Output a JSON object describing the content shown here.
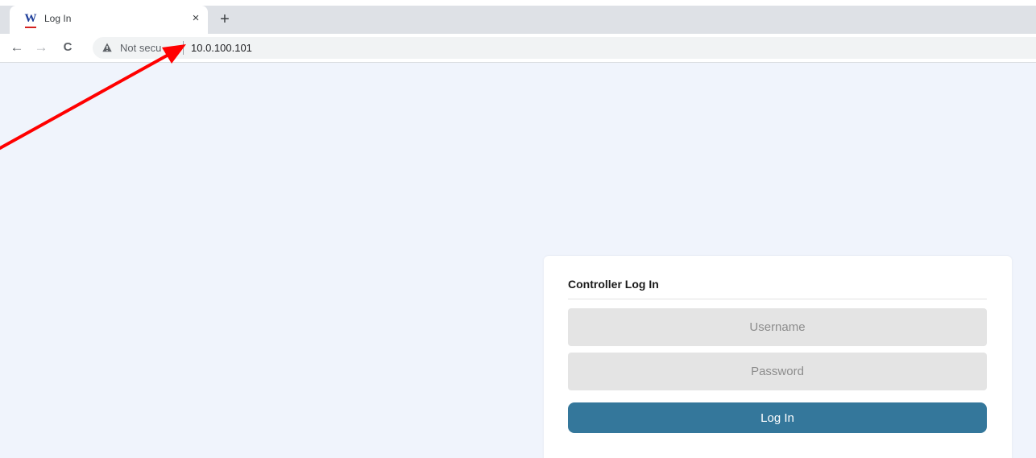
{
  "browser": {
    "tab": {
      "favicon_letter": "W",
      "title": "Log In",
      "close_glyph": "×"
    },
    "new_tab_glyph": "+",
    "nav": {
      "back_glyph": "←",
      "forward_glyph": "→",
      "reload_glyph": "C"
    },
    "omnibox": {
      "security_label": "Not secu",
      "url": "10.0.100.101"
    }
  },
  "login": {
    "title": "Controller Log In",
    "username_placeholder": "Username",
    "password_placeholder": "Password",
    "submit_label": "Log In"
  },
  "colors": {
    "page_background": "#f0f4fc",
    "button_background": "#34779b",
    "annotation_arrow": "#ff0000",
    "favicon_letter": "#1f3f9a",
    "favicon_underline": "#d4211f"
  },
  "icons": {
    "favicon": "w-logo-icon",
    "tab_close": "close-icon",
    "new_tab": "plus-icon",
    "back": "arrow-left-icon",
    "forward": "arrow-right-icon",
    "reload": "reload-icon",
    "security": "warning-triangle-icon",
    "annotation": "red-arrow-icon"
  }
}
